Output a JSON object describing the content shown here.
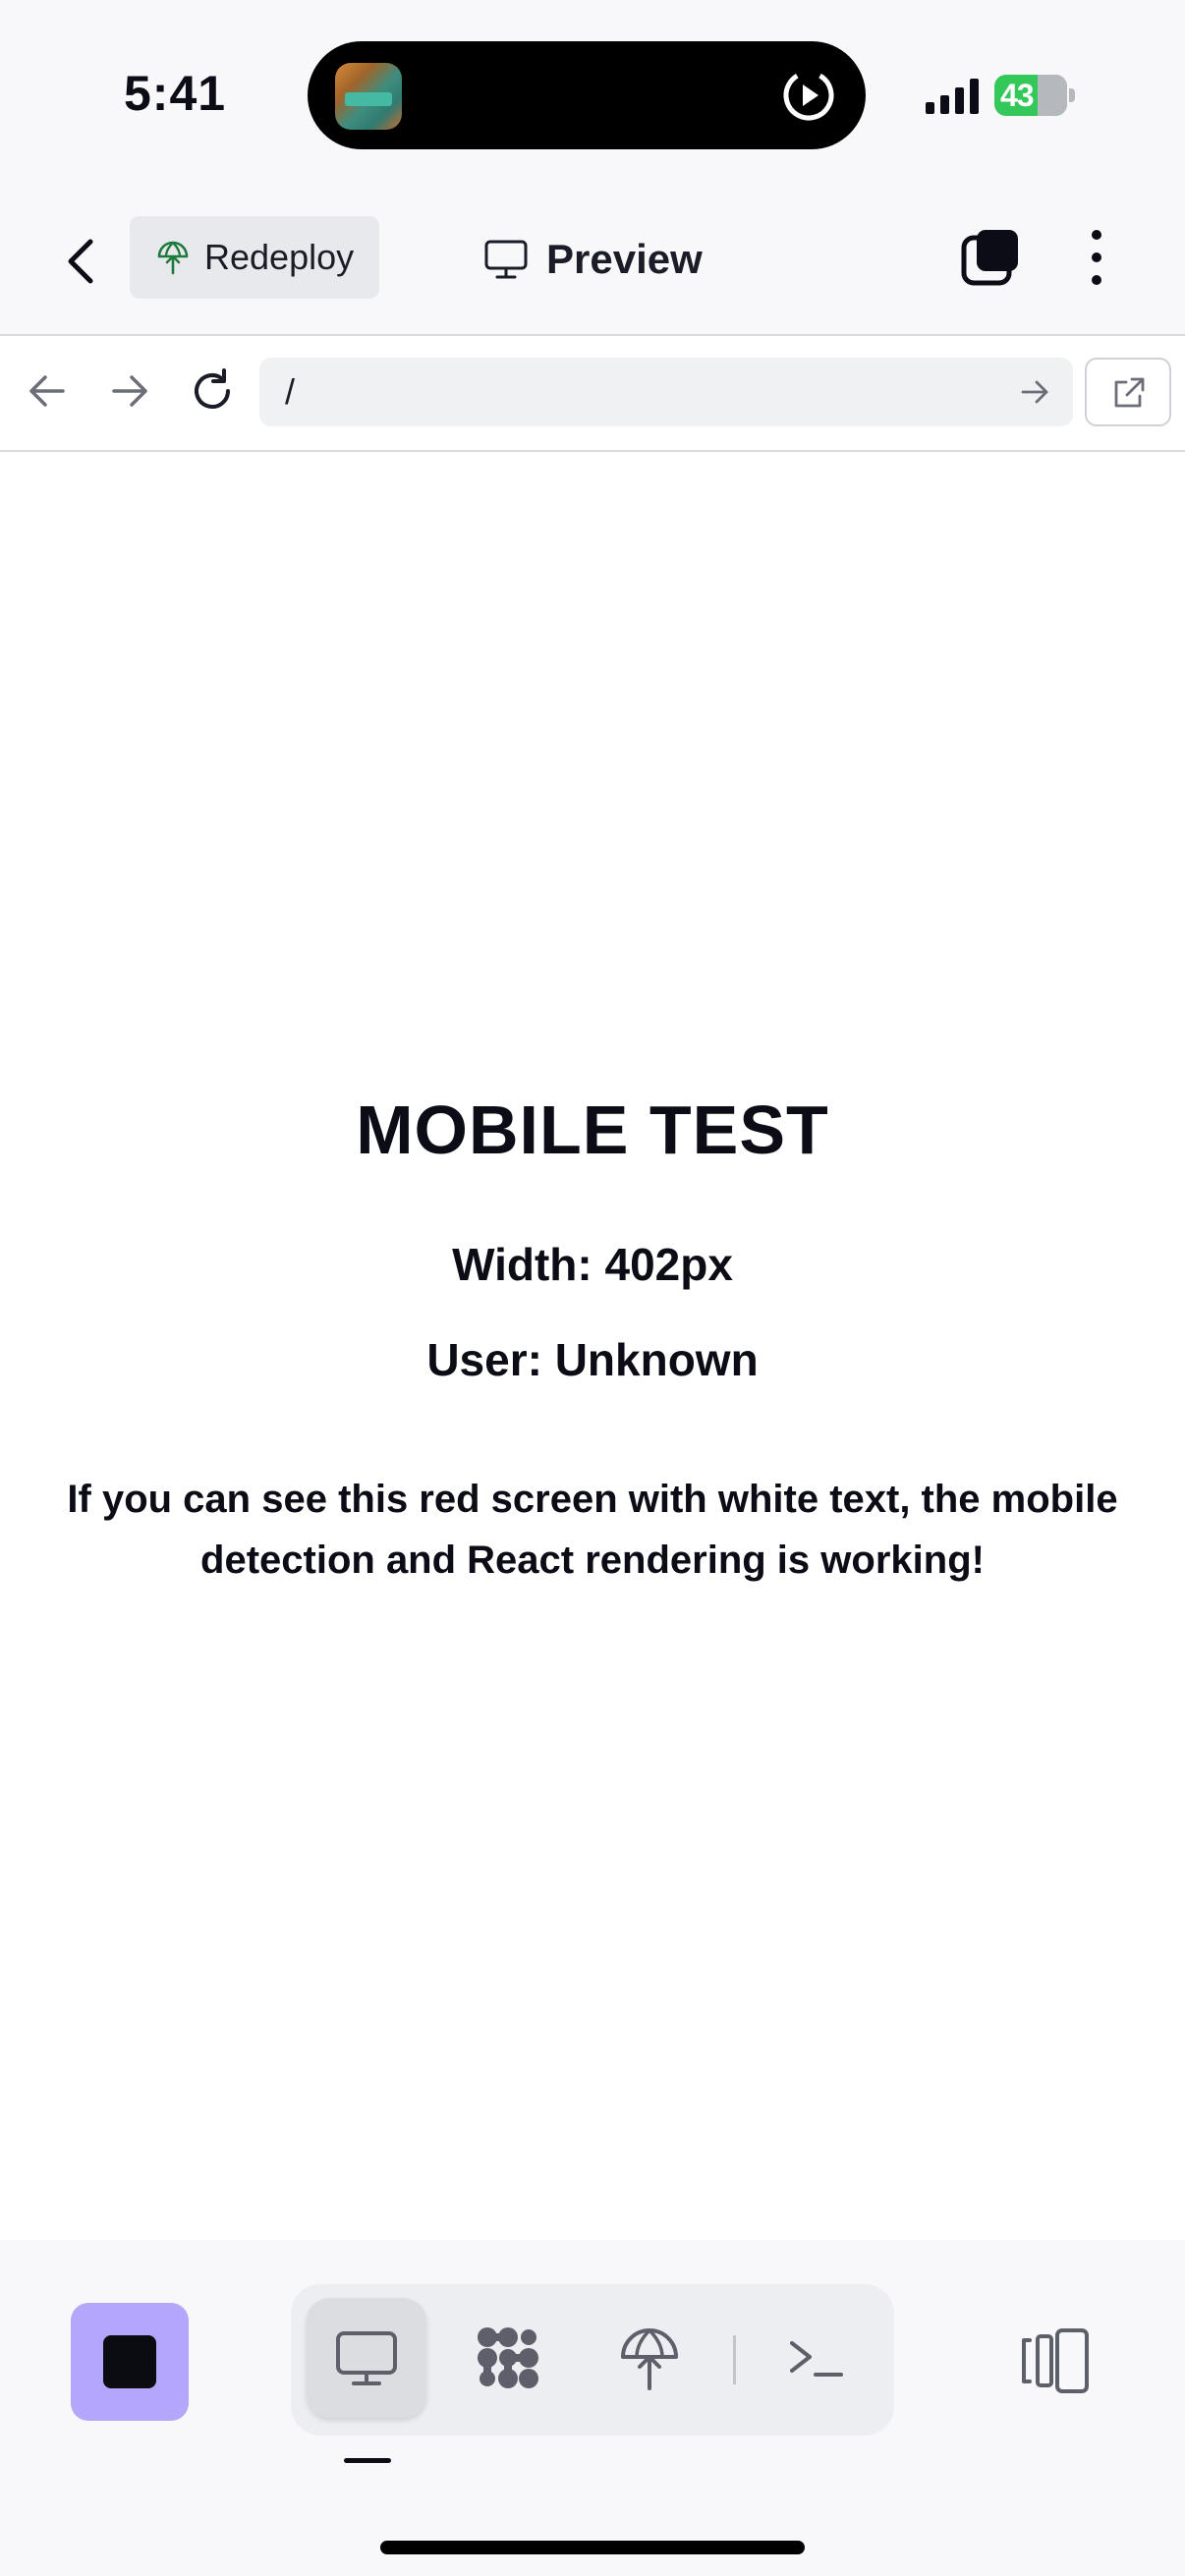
{
  "status_bar": {
    "time": "5:41",
    "battery": "43"
  },
  "header": {
    "redeploy_label": "Redeploy",
    "preview_label": "Preview"
  },
  "browser": {
    "url": "/"
  },
  "preview": {
    "title": "MOBILE TEST",
    "width_line": "Width: 402px",
    "user_line": "User: Unknown",
    "message": "If you can see this red screen with white text, the mobile detection and React rendering is working!"
  },
  "toolbar": {
    "active_tool": "desktop",
    "stop_color": "#b4a6fb",
    "tools": [
      {
        "name": "desktop",
        "icon": "monitor-icon"
      },
      {
        "name": "graph",
        "icon": "workflow-icon"
      },
      {
        "name": "deploy",
        "icon": "deploy-icon"
      },
      {
        "name": "terminal",
        "icon": "terminal-icon"
      }
    ]
  },
  "colors": {
    "accent_green": "#1f7a3e",
    "battery_green": "#34c759"
  }
}
